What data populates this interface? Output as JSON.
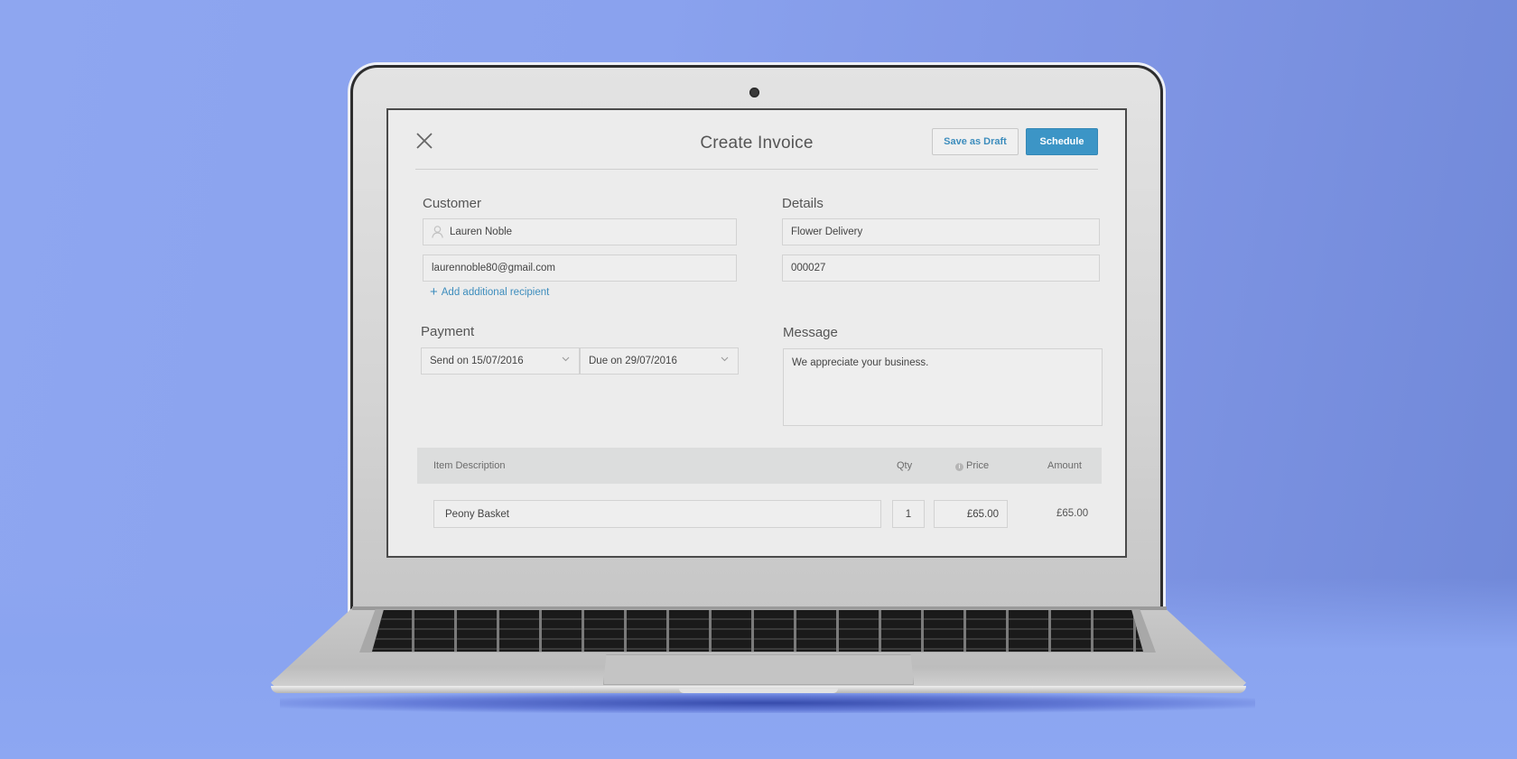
{
  "window": {
    "title": "Create Invoice"
  },
  "header": {
    "close_icon": "close-icon",
    "save_draft_label": "Save as Draft",
    "schedule_label": "Schedule"
  },
  "customer": {
    "label": "Customer",
    "name_value": "Lauren Noble",
    "name_icon": "person-icon",
    "email_value": "laurennoble80@gmail.com",
    "add_recipient_label": "Add additional recipient"
  },
  "details": {
    "label": "Details",
    "title_value": "Flower Delivery",
    "invoice_number_value": "000027"
  },
  "payment": {
    "label": "Payment",
    "send_on": "Send on 15/07/2016",
    "due_on": "Due on 29/07/2016"
  },
  "message": {
    "label": "Message",
    "value": "We appreciate your business."
  },
  "items_table": {
    "columns": {
      "description": "Item Description",
      "qty": "Qty",
      "price": "Price",
      "amount": "Amount"
    },
    "rows": [
      {
        "description": "Peony Basket",
        "qty": "1",
        "price": "£65.00",
        "amount": "£65.00"
      }
    ]
  },
  "colors": {
    "accent": "#3c95c6",
    "link": "#3d8dbd",
    "background": "#8aa2ee"
  }
}
